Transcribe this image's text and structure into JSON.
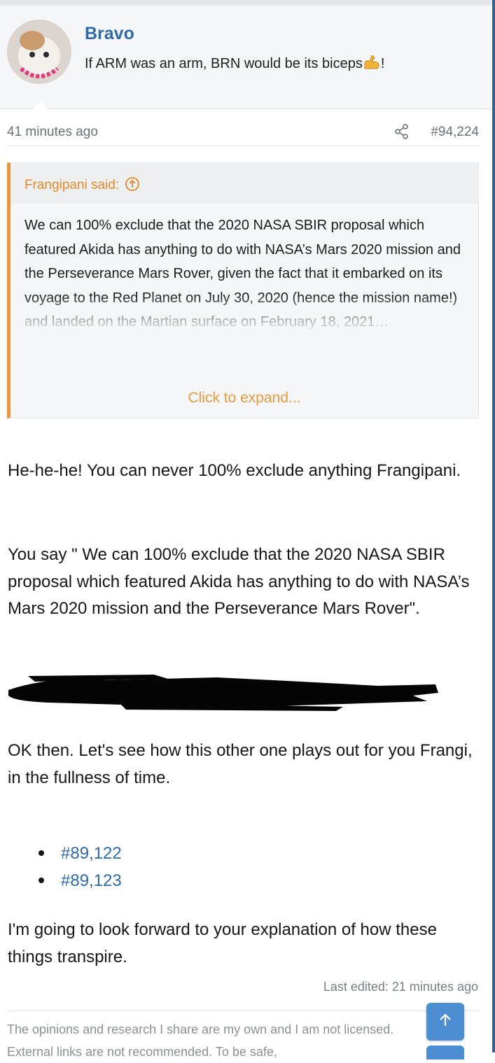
{
  "post": {
    "username": "Bravo",
    "user_title": "If ARM was an arm, BRN would be its biceps",
    "user_title_suffix": "!",
    "timestamp": "41 minutes ago",
    "post_number": "#94,224"
  },
  "quote": {
    "author_label": "Frangipani said:",
    "text": "We can 100% exclude that the 2020 NASA SBIR proposal which featured Akida has anything to do with NASA’s Mars 2020 mission and the Perseverance Mars Rover, given the fact that it embarked on its voyage to the Red Planet on July 30, 2020 (hence the mission name!) and landed on the Martian surface on February 18, 2021…",
    "expand_label": "Click to expand..."
  },
  "body": {
    "paragraph_1": "He-he-he! You can never 100% exclude anything Frangipani.",
    "paragraph_2": "You say \" We can 100% exclude that the 2020 NASA SBIR proposal which featured Akida has anything to do with NASA’s Mars 2020 mission and the Perseverance Mars Rover\".",
    "paragraph_3": "OK then. Let's see how this other one plays out for you Frangi, in the fullness of time.",
    "links": [
      "#89,122",
      "#89,123"
    ],
    "paragraph_4": "I'm going to look forward to your explanation of how these things transpire."
  },
  "footer": {
    "last_edited": "Last edited: 21 minutes ago",
    "signature": "The opinions and research I share are my own and I am not licensed. External links are not recommended. To be safe,"
  },
  "icons": {
    "share": "share-icon",
    "quote_up": "arrow-up-circle-icon",
    "scroll_top": "arrow-up-icon",
    "emoji": "flexed-biceps-icon"
  },
  "colors": {
    "link": "#2f6aa8",
    "quote_accent": "#e9973a",
    "button": "#4c8ed1"
  }
}
